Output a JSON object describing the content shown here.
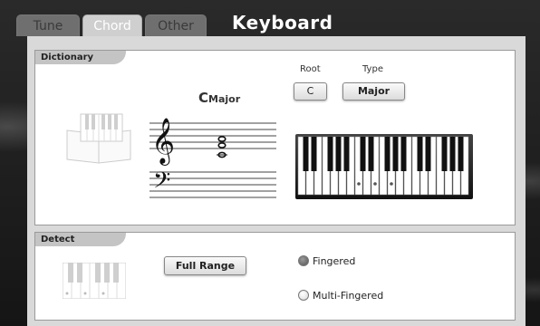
{
  "tabs": [
    {
      "label": "Tune",
      "active": false
    },
    {
      "label": "Chord",
      "active": true
    },
    {
      "label": "Other",
      "active": false
    }
  ],
  "title": "Keyboard",
  "dictionary": {
    "label": "Dictionary",
    "chord_root": "C",
    "chord_quality": "Major",
    "root_label": "Root",
    "root_value": "C",
    "type_label": "Type",
    "type_value": "Major",
    "highlighted_keys": [
      "C",
      "E",
      "G"
    ]
  },
  "detect": {
    "label": "Detect",
    "range_button": "Full Range",
    "options": [
      {
        "label": "Fingered",
        "selected": true
      },
      {
        "label": "Multi-Fingered",
        "selected": false
      }
    ]
  },
  "icons": {
    "book_keyboard": "keyboard-book-icon",
    "detect_keyboard": "small-keyboard-icon"
  }
}
